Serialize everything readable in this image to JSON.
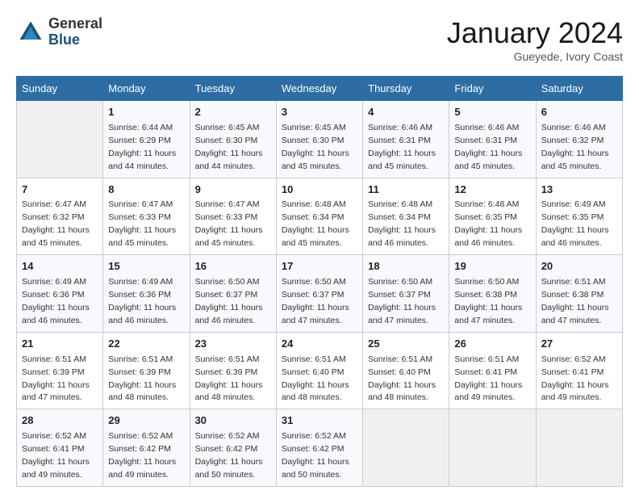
{
  "header": {
    "logo_general": "General",
    "logo_blue": "Blue",
    "month": "January 2024",
    "location": "Gueyede, Ivory Coast"
  },
  "days_of_week": [
    "Sunday",
    "Monday",
    "Tuesday",
    "Wednesday",
    "Thursday",
    "Friday",
    "Saturday"
  ],
  "weeks": [
    [
      {
        "day": "",
        "sunrise": "",
        "sunset": "",
        "daylight": "",
        "empty": true
      },
      {
        "day": "1",
        "sunrise": "Sunrise: 6:44 AM",
        "sunset": "Sunset: 6:29 PM",
        "daylight": "Daylight: 11 hours and 44 minutes."
      },
      {
        "day": "2",
        "sunrise": "Sunrise: 6:45 AM",
        "sunset": "Sunset: 6:30 PM",
        "daylight": "Daylight: 11 hours and 44 minutes."
      },
      {
        "day": "3",
        "sunrise": "Sunrise: 6:45 AM",
        "sunset": "Sunset: 6:30 PM",
        "daylight": "Daylight: 11 hours and 45 minutes."
      },
      {
        "day": "4",
        "sunrise": "Sunrise: 6:46 AM",
        "sunset": "Sunset: 6:31 PM",
        "daylight": "Daylight: 11 hours and 45 minutes."
      },
      {
        "day": "5",
        "sunrise": "Sunrise: 6:46 AM",
        "sunset": "Sunset: 6:31 PM",
        "daylight": "Daylight: 11 hours and 45 minutes."
      },
      {
        "day": "6",
        "sunrise": "Sunrise: 6:46 AM",
        "sunset": "Sunset: 6:32 PM",
        "daylight": "Daylight: 11 hours and 45 minutes."
      }
    ],
    [
      {
        "day": "7",
        "sunrise": "Sunrise: 6:47 AM",
        "sunset": "Sunset: 6:32 PM",
        "daylight": "Daylight: 11 hours and 45 minutes."
      },
      {
        "day": "8",
        "sunrise": "Sunrise: 6:47 AM",
        "sunset": "Sunset: 6:33 PM",
        "daylight": "Daylight: 11 hours and 45 minutes."
      },
      {
        "day": "9",
        "sunrise": "Sunrise: 6:47 AM",
        "sunset": "Sunset: 6:33 PM",
        "daylight": "Daylight: 11 hours and 45 minutes."
      },
      {
        "day": "10",
        "sunrise": "Sunrise: 6:48 AM",
        "sunset": "Sunset: 6:34 PM",
        "daylight": "Daylight: 11 hours and 45 minutes."
      },
      {
        "day": "11",
        "sunrise": "Sunrise: 6:48 AM",
        "sunset": "Sunset: 6:34 PM",
        "daylight": "Daylight: 11 hours and 46 minutes."
      },
      {
        "day": "12",
        "sunrise": "Sunrise: 6:48 AM",
        "sunset": "Sunset: 6:35 PM",
        "daylight": "Daylight: 11 hours and 46 minutes."
      },
      {
        "day": "13",
        "sunrise": "Sunrise: 6:49 AM",
        "sunset": "Sunset: 6:35 PM",
        "daylight": "Daylight: 11 hours and 46 minutes."
      }
    ],
    [
      {
        "day": "14",
        "sunrise": "Sunrise: 6:49 AM",
        "sunset": "Sunset: 6:36 PM",
        "daylight": "Daylight: 11 hours and 46 minutes."
      },
      {
        "day": "15",
        "sunrise": "Sunrise: 6:49 AM",
        "sunset": "Sunset: 6:36 PM",
        "daylight": "Daylight: 11 hours and 46 minutes."
      },
      {
        "day": "16",
        "sunrise": "Sunrise: 6:50 AM",
        "sunset": "Sunset: 6:37 PM",
        "daylight": "Daylight: 11 hours and 46 minutes."
      },
      {
        "day": "17",
        "sunrise": "Sunrise: 6:50 AM",
        "sunset": "Sunset: 6:37 PM",
        "daylight": "Daylight: 11 hours and 47 minutes."
      },
      {
        "day": "18",
        "sunrise": "Sunrise: 6:50 AM",
        "sunset": "Sunset: 6:37 PM",
        "daylight": "Daylight: 11 hours and 47 minutes."
      },
      {
        "day": "19",
        "sunrise": "Sunrise: 6:50 AM",
        "sunset": "Sunset: 6:38 PM",
        "daylight": "Daylight: 11 hours and 47 minutes."
      },
      {
        "day": "20",
        "sunrise": "Sunrise: 6:51 AM",
        "sunset": "Sunset: 6:38 PM",
        "daylight": "Daylight: 11 hours and 47 minutes."
      }
    ],
    [
      {
        "day": "21",
        "sunrise": "Sunrise: 6:51 AM",
        "sunset": "Sunset: 6:39 PM",
        "daylight": "Daylight: 11 hours and 47 minutes."
      },
      {
        "day": "22",
        "sunrise": "Sunrise: 6:51 AM",
        "sunset": "Sunset: 6:39 PM",
        "daylight": "Daylight: 11 hours and 48 minutes."
      },
      {
        "day": "23",
        "sunrise": "Sunrise: 6:51 AM",
        "sunset": "Sunset: 6:39 PM",
        "daylight": "Daylight: 11 hours and 48 minutes."
      },
      {
        "day": "24",
        "sunrise": "Sunrise: 6:51 AM",
        "sunset": "Sunset: 6:40 PM",
        "daylight": "Daylight: 11 hours and 48 minutes."
      },
      {
        "day": "25",
        "sunrise": "Sunrise: 6:51 AM",
        "sunset": "Sunset: 6:40 PM",
        "daylight": "Daylight: 11 hours and 48 minutes."
      },
      {
        "day": "26",
        "sunrise": "Sunrise: 6:51 AM",
        "sunset": "Sunset: 6:41 PM",
        "daylight": "Daylight: 11 hours and 49 minutes."
      },
      {
        "day": "27",
        "sunrise": "Sunrise: 6:52 AM",
        "sunset": "Sunset: 6:41 PM",
        "daylight": "Daylight: 11 hours and 49 minutes."
      }
    ],
    [
      {
        "day": "28",
        "sunrise": "Sunrise: 6:52 AM",
        "sunset": "Sunset: 6:41 PM",
        "daylight": "Daylight: 11 hours and 49 minutes."
      },
      {
        "day": "29",
        "sunrise": "Sunrise: 6:52 AM",
        "sunset": "Sunset: 6:42 PM",
        "daylight": "Daylight: 11 hours and 49 minutes."
      },
      {
        "day": "30",
        "sunrise": "Sunrise: 6:52 AM",
        "sunset": "Sunset: 6:42 PM",
        "daylight": "Daylight: 11 hours and 50 minutes."
      },
      {
        "day": "31",
        "sunrise": "Sunrise: 6:52 AM",
        "sunset": "Sunset: 6:42 PM",
        "daylight": "Daylight: 11 hours and 50 minutes."
      },
      {
        "day": "",
        "sunrise": "",
        "sunset": "",
        "daylight": "",
        "empty": true
      },
      {
        "day": "",
        "sunrise": "",
        "sunset": "",
        "daylight": "",
        "empty": true
      },
      {
        "day": "",
        "sunrise": "",
        "sunset": "",
        "daylight": "",
        "empty": true
      }
    ]
  ]
}
